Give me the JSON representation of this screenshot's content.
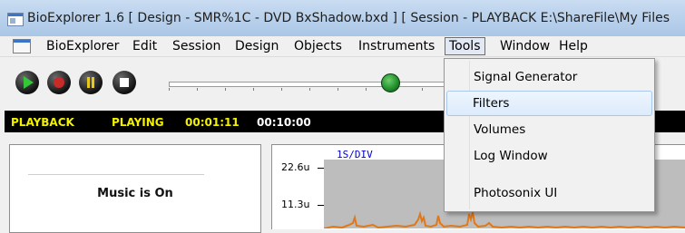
{
  "window": {
    "title": "BioExplorer 1.6  [ Design - SMR%1C - DVD BxShadow.bxd ] [ Session - PLAYBACK E:\\ShareFile\\My Files"
  },
  "menubar": {
    "items": [
      "BioExplorer",
      "Edit",
      "Session",
      "Design",
      "Objects",
      "Instruments",
      "Tools",
      "Window",
      "Help"
    ],
    "active": "Tools"
  },
  "toolbar": {
    "play_icon": "play-icon",
    "record_icon": "record-icon",
    "pause_icon": "pause-icon",
    "stop_icon": "stop-icon",
    "colors": {
      "play": "#32c83a",
      "record": "#c92a2a",
      "pause": "#e8c81a",
      "stop": "#ffffff"
    }
  },
  "status": {
    "mode": "PLAYBACK",
    "state": "PLAYING",
    "elapsed": "00:01:11",
    "total": "00:10:00"
  },
  "music_panel": {
    "text": "Music is On"
  },
  "scope": {
    "scale": "1S/DIV",
    "y_labels": [
      "22.6u",
      "11.3u"
    ]
  },
  "tools_menu": {
    "items": [
      {
        "label": "Signal Generator"
      },
      {
        "label": "Filters"
      },
      {
        "label": "Volumes"
      },
      {
        "label": "Log Window"
      },
      {
        "label": "Photosonix UI"
      }
    ],
    "highlighted": "Filters"
  }
}
